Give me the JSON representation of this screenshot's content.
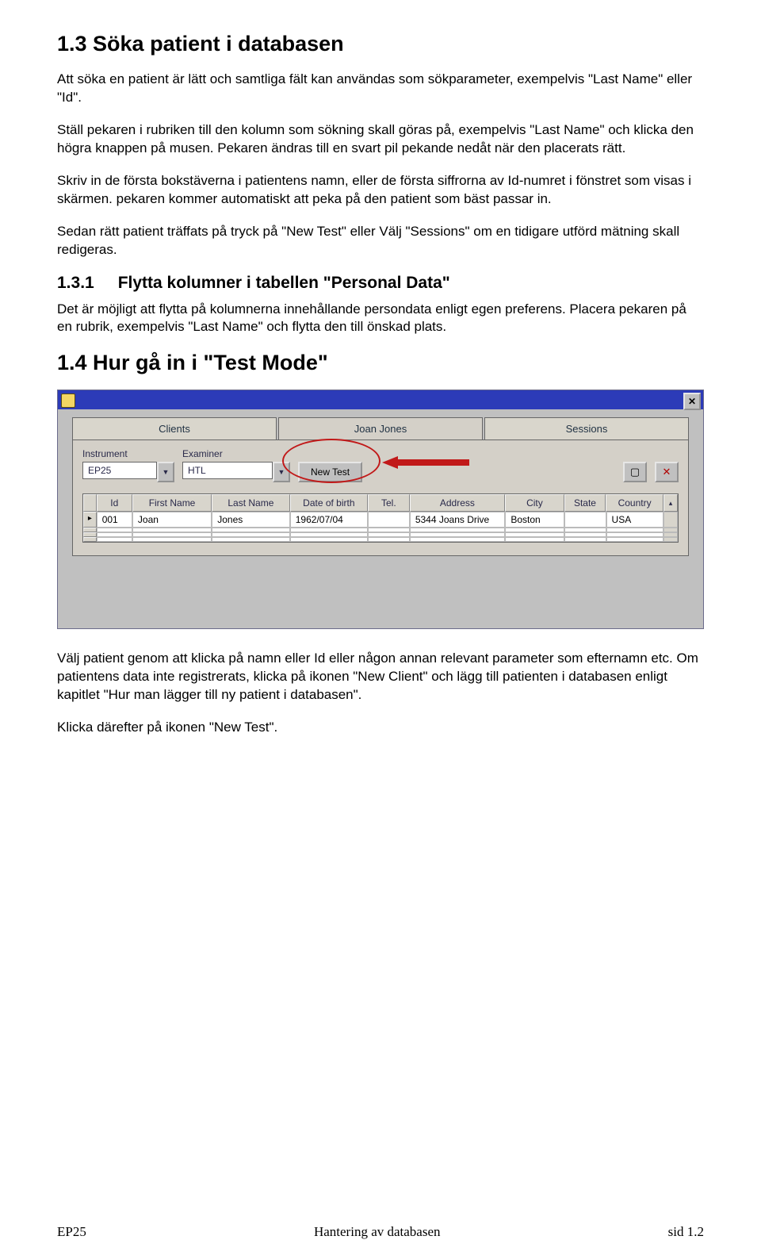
{
  "headings": {
    "h13": "1.3 Söka patient i databasen",
    "h131_num": "1.3.1",
    "h131_title": "Flytta kolumner i tabellen \"Personal Data\"",
    "h14": "1.4 Hur gå in i \"Test Mode\""
  },
  "paragraphs": {
    "p1": "Att söka en patient är lätt och samtliga fält kan användas som sökparameter, exempelvis \"Last Name\" eller \"Id\".",
    "p2": "Ställ pekaren i rubriken till den kolumn som sökning skall göras på, exempelvis \"Last Name\" och klicka den högra knappen på musen. Pekaren ändras till en svart pil pekande nedåt när den placerats rätt.",
    "p3": "Skriv in de första bokstäverna i patientens namn, eller de första siffrorna av Id-numret i fönstret som visas i skärmen. pekaren kommer automatiskt att peka på den patient som bäst passar in.",
    "p4": "Sedan rätt patient träffats på tryck på  \"New Test\" eller Välj \"Sessions\" om en tidigare utförd mätning skall redigeras.",
    "p5": "Det är möjligt att flytta på kolumnerna innehållande persondata enligt egen preferens. Placera pekaren på en rubrik, exempelvis \"Last Name\" och flytta den till önskad plats.",
    "p6": "Välj patient genom att klicka på namn eller Id eller någon annan relevant parameter som efternamn etc. Om patientens data inte registrerats, klicka på ikonen \"New Client\" och lägg till patienten i databasen enligt kapitlet \"Hur man lägger till ny patient i databasen\".",
    "p7": "Klicka därefter på ikonen \"New Test\"."
  },
  "ui": {
    "tabs": {
      "clients": "Clients",
      "current": "Joan Jones",
      "sessions": "Sessions"
    },
    "labels": {
      "instrument": "Instrument",
      "examiner": "Examiner"
    },
    "values": {
      "instrument": "EP25",
      "examiner": "HTL",
      "newtest": "New Test"
    },
    "columns": {
      "id": "Id",
      "first": "First Name",
      "last": "Last Name",
      "dob": "Date of birth",
      "tel": "Tel.",
      "addr": "Address",
      "city": "City",
      "state": "State",
      "country": "Country"
    },
    "row": {
      "id": "001",
      "first": "Joan",
      "last": "Jones",
      "dob": "1962/07/04",
      "tel": "",
      "addr": "5344 Joans Drive",
      "city": "Boston",
      "state": "",
      "country": "USA"
    },
    "icons": {
      "close": "✕",
      "dropdown": "▼",
      "doc": "▢",
      "del": "✕",
      "rowptr": "▸",
      "scrollup": "▴"
    }
  },
  "footer": {
    "left": "EP25",
    "center": "Hantering av databasen",
    "right": "sid 1.2"
  }
}
